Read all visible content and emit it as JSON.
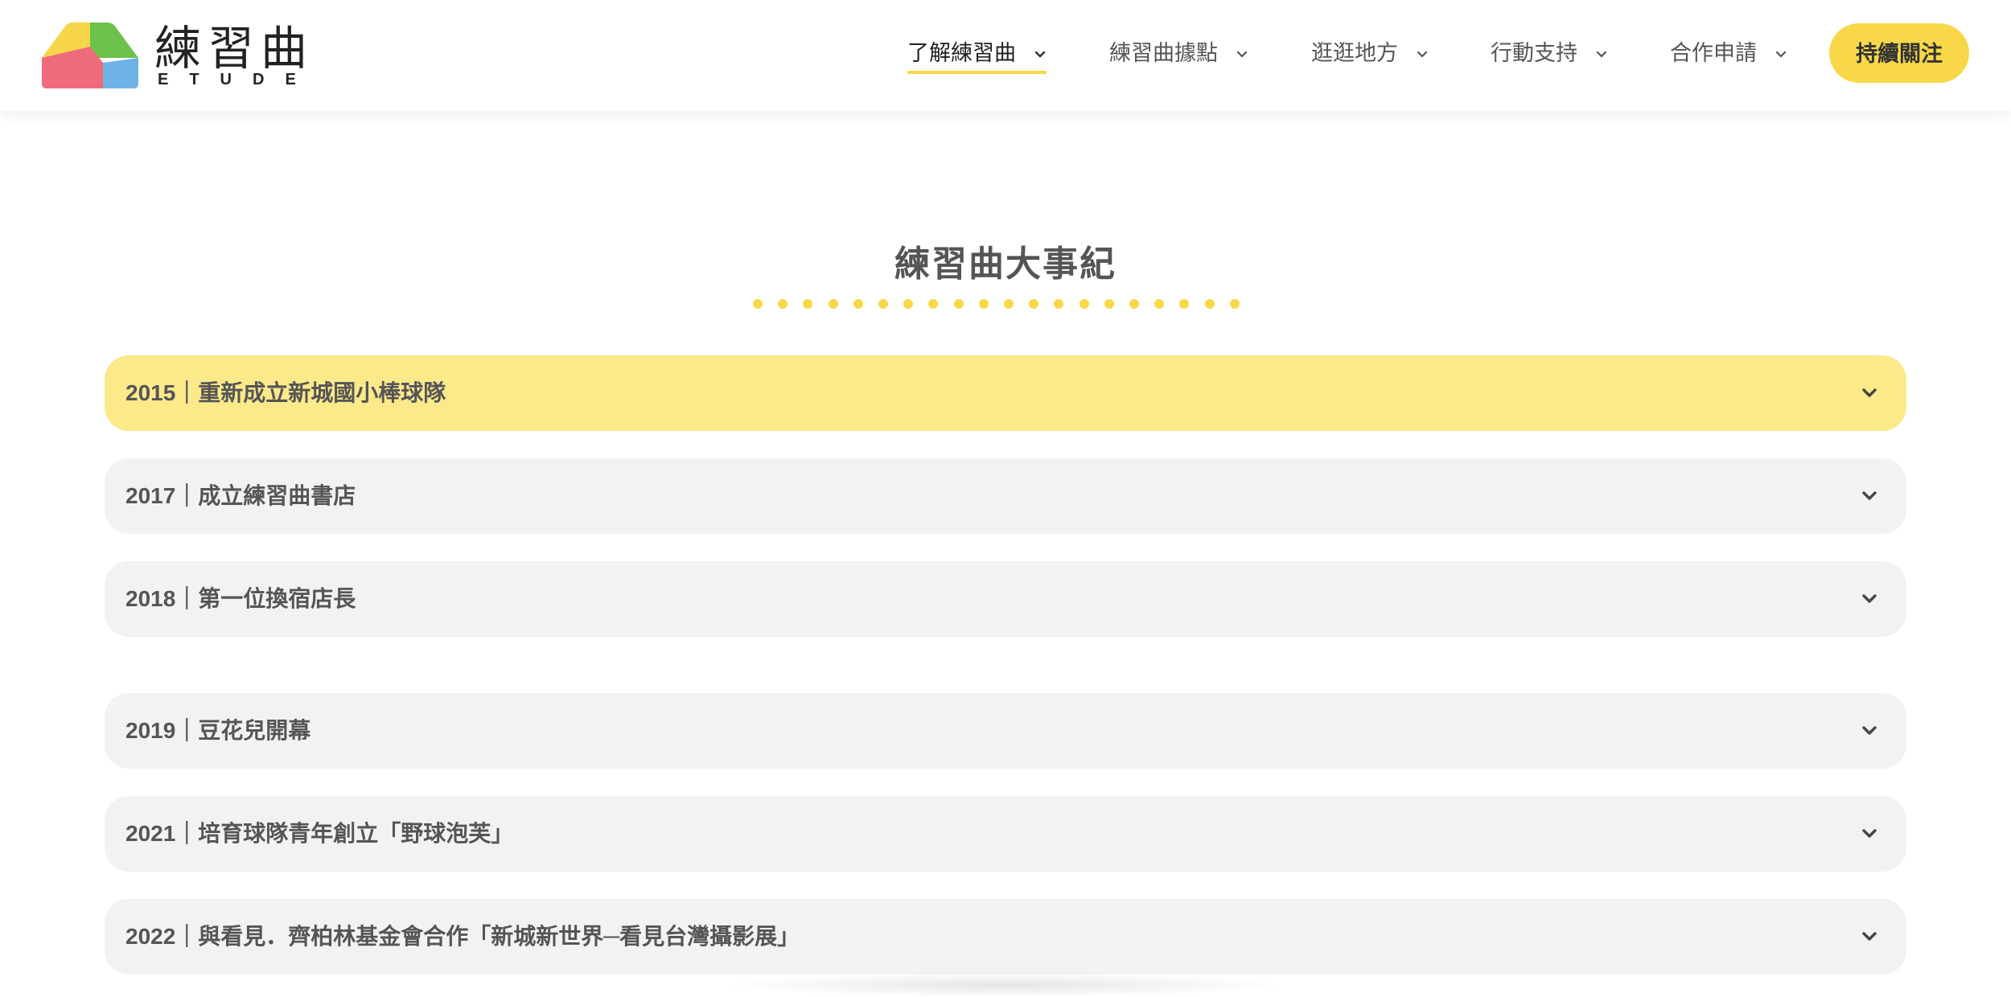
{
  "brand": {
    "name": "練習曲",
    "sub": "ETUDE"
  },
  "nav": {
    "items": [
      {
        "label": "了解練習曲"
      },
      {
        "label": "練習曲據點"
      },
      {
        "label": "逛逛地方"
      },
      {
        "label": "行動支持"
      },
      {
        "label": "合作申請"
      }
    ],
    "cta": "持續關注"
  },
  "section": {
    "title": "練習曲大事紀"
  },
  "timeline": [
    {
      "label": "2015｜重新成立新城國小棒球隊",
      "open": true
    },
    {
      "label": "2017｜成立練習曲書店",
      "open": false
    },
    {
      "label": "2018｜第一位換宿店長",
      "open": false
    },
    {
      "label": "2019｜豆花兒開幕",
      "open": false
    },
    {
      "label": "2021｜培育球隊青年創立「野球泡芙」",
      "open": false
    },
    {
      "label": "2022｜與看見．齊柏林基金會合作「新城新世界─看見台灣攝影展」",
      "open": false
    }
  ],
  "colors": {
    "accent": "#f8d848",
    "open_row": "#fbe98a",
    "row": "#f2f2f2",
    "logo_yellow": "#f7d54a",
    "logo_green": "#6cc24a",
    "logo_red": "#ef6b7b",
    "logo_blue": "#6db3e6"
  },
  "icons": {
    "nav_chevron": "chevron-down-icon",
    "row_chevron": "chevron-down-icon"
  }
}
